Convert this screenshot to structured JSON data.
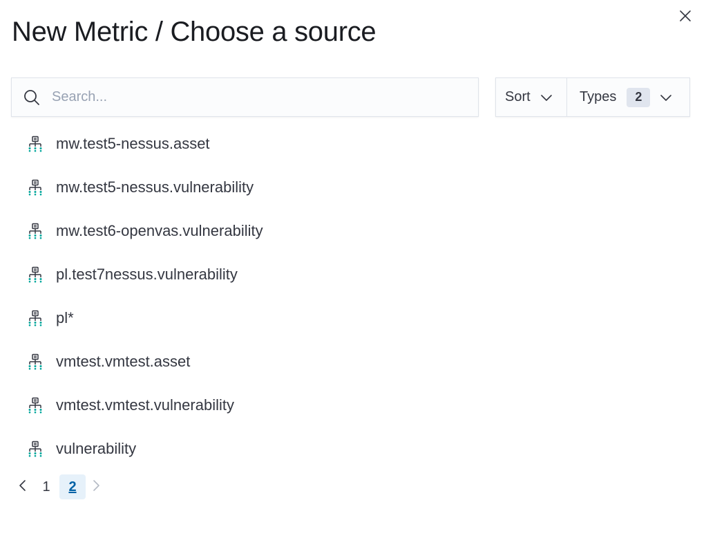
{
  "header": {
    "title": "New Metric / Choose a source"
  },
  "search": {
    "placeholder": "Search...",
    "value": ""
  },
  "filters": {
    "sort_label": "Sort",
    "types_label": "Types",
    "types_count": "2"
  },
  "sources": {
    "icon": "index-pattern-icon",
    "items": [
      {
        "label": "mw.test5-nessus.asset"
      },
      {
        "label": "mw.test5-nessus.vulnerability"
      },
      {
        "label": "mw.test6-openvas.vulnerability"
      },
      {
        "label": "pl.test7nessus.vulnerability"
      },
      {
        "label": "pl*"
      },
      {
        "label": "vmtest.vmtest.asset"
      },
      {
        "label": "vmtest.vmtest.vulnerability"
      },
      {
        "label": "vulnerability"
      }
    ]
  },
  "pagination": {
    "pages": [
      "1",
      "2"
    ],
    "current_page": "2"
  },
  "colors": {
    "title": "#1a1c21",
    "text": "#343741",
    "icon_accent": "#00a69b",
    "active_page_bg": "#e6f1fa",
    "active_page_text": "#0061a6"
  }
}
